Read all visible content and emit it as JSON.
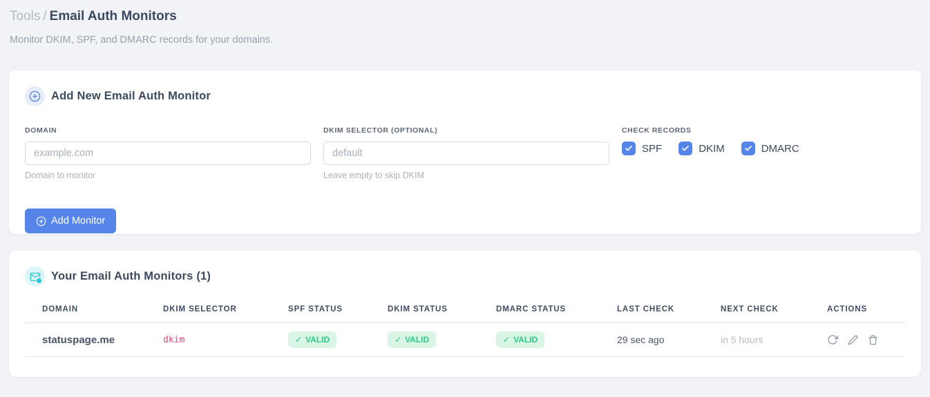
{
  "page": {
    "breadcrumb": "Tools",
    "breadcrumb_separator": "/",
    "title": "Email Auth Monitors",
    "subtitle": "Monitor DKIM, SPF, and DMARC records for your domains."
  },
  "add_monitor": {
    "title": "Add New Email Auth Monitor",
    "fields": {
      "domain": {
        "label": "DOMAIN",
        "placeholder": "example.com",
        "value": "",
        "hint": "Domain to monitor"
      },
      "dkim_selector": {
        "label": "DKIM SELECTOR (OPTIONAL)",
        "placeholder": "default",
        "value": "",
        "hint": "Leave empty to skip DKIM"
      }
    },
    "check_records": {
      "label": "CHECK RECORDS",
      "options": [
        {
          "label": "SPF",
          "checked": true
        },
        {
          "label": "DKIM",
          "checked": true
        },
        {
          "label": "DMARC",
          "checked": true
        }
      ]
    },
    "submit_label": "Add Monitor"
  },
  "monitors": {
    "title": "Your Email Auth Monitors (1)",
    "count": 1,
    "table": {
      "columns": [
        "DOMAIN",
        "DKIM SELECTOR",
        "SPF STATUS",
        "DKIM STATUS",
        "DMARC STATUS",
        "LAST CHECK",
        "NEXT CHECK",
        "ACTIONS"
      ],
      "rows": [
        {
          "domain": "statuspage.me",
          "dkim_selector": "dkim",
          "spf_status": "VALID",
          "dkim_status": "VALID",
          "dmarc_status": "VALID",
          "last_check": "29 sec ago",
          "next_check": "in 5 hours",
          "actions": [
            "refresh",
            "edit",
            "delete"
          ]
        }
      ]
    }
  },
  "icons": {
    "plus_circle": "plus-circle",
    "envelope_check": "envelope-with-check-badge",
    "badge_check_glyph": "✓",
    "refresh": "circular-arrow",
    "edit": "pencil",
    "delete": "trash"
  },
  "colors": {
    "accent_blue": "#5585e8",
    "accent_cyan": "#27c6d9",
    "badge_green_bg": "#d8f5e5",
    "badge_green_text": "#2fc983",
    "selector_pink": "#e8447c",
    "page_background": "#f1f3f6"
  }
}
